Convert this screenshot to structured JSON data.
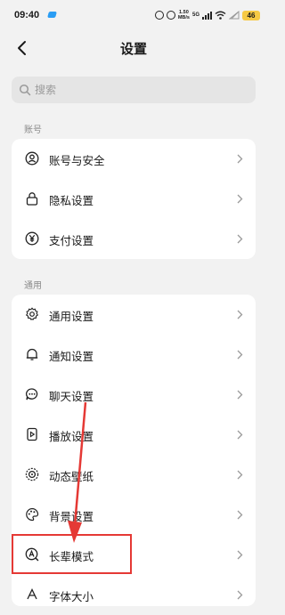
{
  "status_bar": {
    "time": "09:40",
    "speed_value": "1.50",
    "speed_unit": "MB/s",
    "signal": "5G",
    "battery": "46"
  },
  "header": {
    "title": "设置"
  },
  "search": {
    "placeholder": "搜索"
  },
  "sections": [
    {
      "label": "账号",
      "items": [
        {
          "label": "账号与安全",
          "icon": "account-circle-icon"
        },
        {
          "label": "隐私设置",
          "icon": "lock-icon"
        },
        {
          "label": "支付设置",
          "icon": "yen-circle-icon"
        }
      ]
    },
    {
      "label": "通用",
      "items": [
        {
          "label": "通用设置",
          "icon": "gear-icon"
        },
        {
          "label": "通知设置",
          "icon": "bell-icon"
        },
        {
          "label": "聊天设置",
          "icon": "chat-bubble-icon"
        },
        {
          "label": "播放设置",
          "icon": "play-device-icon"
        },
        {
          "label": "动态壁纸",
          "icon": "live-wallpaper-icon"
        },
        {
          "label": "背景设置",
          "icon": "palette-icon"
        },
        {
          "label": "长辈模式",
          "icon": "elder-mode-icon"
        },
        {
          "label": "字体大小",
          "icon": "font-icon"
        }
      ]
    }
  ],
  "annotation": {
    "color": "#e53935"
  }
}
